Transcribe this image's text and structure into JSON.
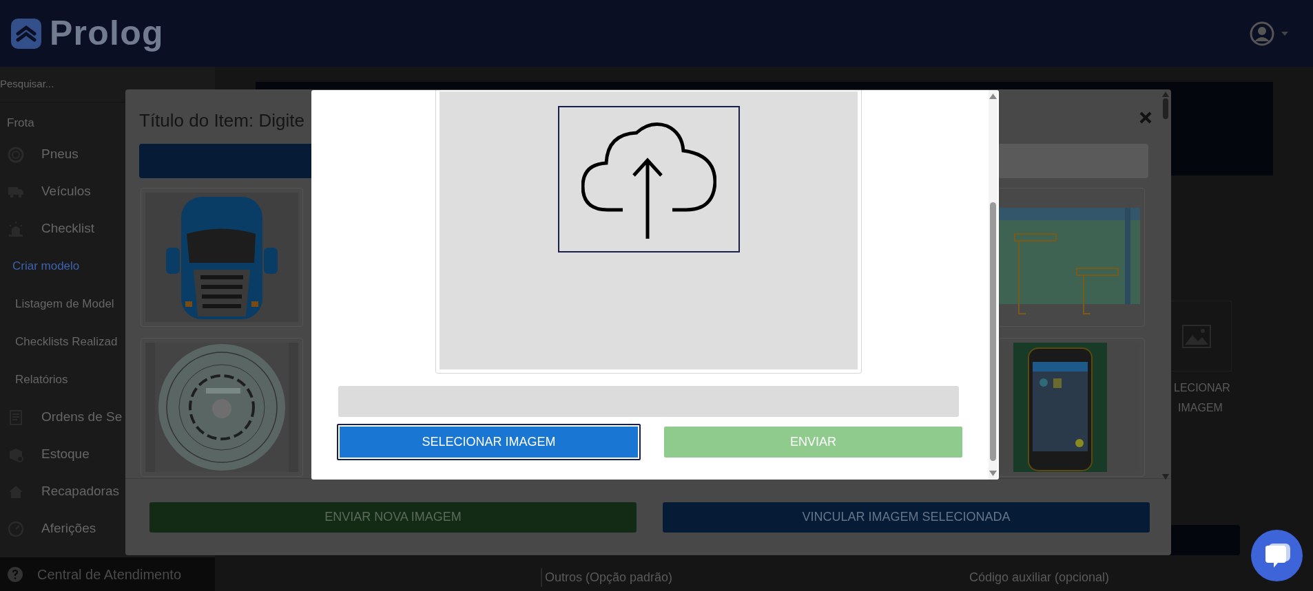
{
  "header": {
    "logo": "Prolog"
  },
  "sidebar": {
    "search_placeholder": "Pesquisar...",
    "section": "Frota",
    "items": [
      {
        "label": "Pneus"
      },
      {
        "label": "Veículos"
      },
      {
        "label": "Checklist",
        "children": [
          {
            "label": "Criar modelo",
            "selected": true
          },
          {
            "label": "Listagem de Model",
            "selected": false
          },
          {
            "label": "Checklists Realizad",
            "selected": false
          },
          {
            "label": "Relatórios",
            "selected": false
          }
        ]
      },
      {
        "label": "Ordens de Se"
      },
      {
        "label": "Estoque"
      },
      {
        "label": "Recapadoras"
      },
      {
        "label": "Aferições"
      }
    ],
    "footer": "Central de Atendimento"
  },
  "background_page": {
    "button_text": [
      "LECIONAR",
      "IMAGEM"
    ],
    "field_labels": [
      "Outros (Opção padrão)",
      "Código auxiliar (opcional)"
    ]
  },
  "gallery_dialog": {
    "title": "Título do Item: Digite",
    "buttons": [
      {
        "label": "ENVIAR NOVA IMAGEM",
        "kind": "green"
      },
      {
        "label": "VINCULAR IMAGEM SELECIONADA",
        "kind": "blue"
      }
    ]
  },
  "upload_dialog": {
    "progress": {
      "level": 0
    },
    "buttons": [
      {
        "label": "SELECIONAR IMAGEM",
        "kind": "primary",
        "focused": true,
        "disabled": false
      },
      {
        "label": "ENVIAR",
        "kind": "submit",
        "focused": false,
        "disabled": true
      }
    ]
  }
}
